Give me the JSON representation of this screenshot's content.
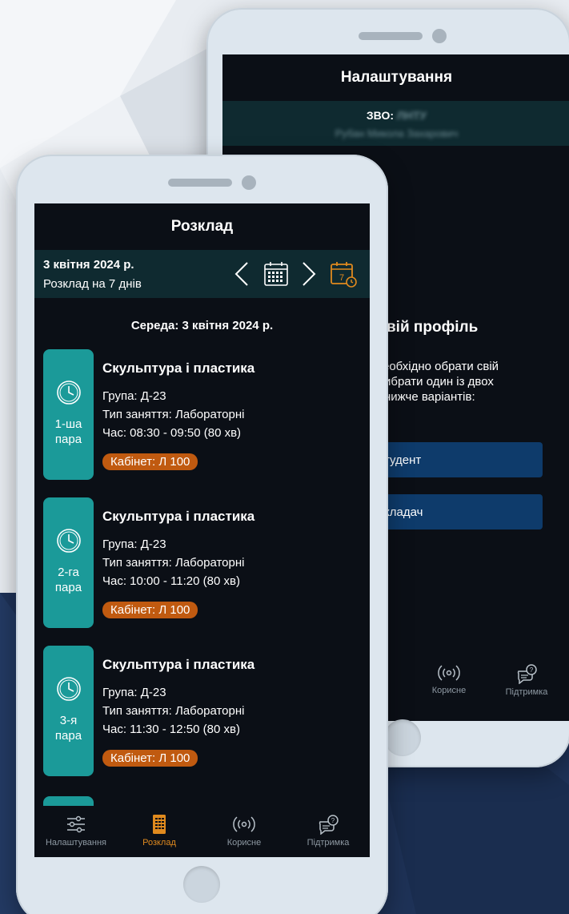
{
  "colors": {
    "screen_bg": "#0b0f16",
    "bar_bg": "#0f2a30",
    "teal": "#1b9a99",
    "badge": "#c05a10",
    "accent": "#e08a1e",
    "role_button": "#0e3b6b",
    "muted": "#8e99a3"
  },
  "settings_screen": {
    "title": "Налаштування",
    "zvo_label": "ЗВО:",
    "zvo_value": "ЛНТУ",
    "user_name": "Рубан Микола Захарович",
    "profile_title": "вій профіль",
    "profile_text_1": "еобхідно обрати свій",
    "profile_text_2": "вибрати один із двох",
    "profile_text_3": "нижче варіантів:",
    "role_student": "тудент",
    "role_teacher": "кладач",
    "nav": [
      {
        "label": "Корисне",
        "icon": "broadcast-icon"
      },
      {
        "label": "Підтримка",
        "icon": "support-chat-icon"
      }
    ]
  },
  "schedule_screen": {
    "title": "Розклад",
    "date": "3 квітня 2024 р.",
    "range_label": "Розклад на 7 днів",
    "seven_day_badge": "7",
    "day_title": "Середа: 3 квітня 2024 р.",
    "lessons": [
      {
        "pair_line1": "1-ша",
        "pair_line2": "пара",
        "subject": "Скульптура і пластика",
        "group": "Група: Д-23",
        "type": "Тип заняття: Лабораторні",
        "time": "Час: 08:30 - 09:50 (80 хв)",
        "room": "Кабінет: Л 100"
      },
      {
        "pair_line1": "2-га",
        "pair_line2": "пара",
        "subject": "Скульптура і пластика",
        "group": "Група: Д-23",
        "type": "Тип заняття: Лабораторні",
        "time": "Час: 10:00 - 11:20 (80 хв)",
        "room": "Кабінет: Л 100"
      },
      {
        "pair_line1": "3-я",
        "pair_line2": "пара",
        "subject": "Скульптура і пластика",
        "group": "Група: Д-23",
        "type": "Тип заняття: Лабораторні",
        "time": "Час: 11:30 - 12:50 (80 хв)",
        "room": "Кабінет: Л 100"
      }
    ],
    "nav": [
      {
        "label": "Налаштування",
        "icon": "sliders-icon",
        "active": false
      },
      {
        "label": "Розклад",
        "icon": "schedule-icon",
        "active": true
      },
      {
        "label": "Корисне",
        "icon": "broadcast-icon",
        "active": false
      },
      {
        "label": "Підтримка",
        "icon": "support-chat-icon",
        "active": false
      }
    ]
  }
}
